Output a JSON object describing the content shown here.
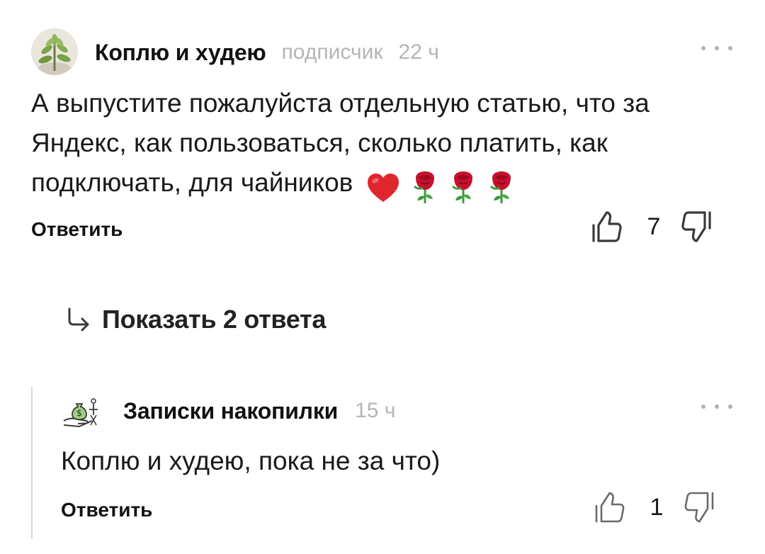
{
  "comment_main": {
    "author": "Коплю и худею",
    "role": "подписчик",
    "time": "22 ч",
    "text": "А выпустите пожалуйста отдельную статью, что за Яндекс, как пользоваться, сколько платить, как подключать, для чайников",
    "emojis": [
      "heart-emoji",
      "rose-emoji",
      "rose-emoji",
      "rose-emoji"
    ],
    "reply_label": "Ответить",
    "likes": "7",
    "avatar_icon": "succulent-plant-avatar"
  },
  "show_replies": {
    "label": "Показать 2 ответа",
    "icon": "reply-arrow-icon"
  },
  "comment_reply": {
    "author": "Записки накопилки",
    "time": "15 ч",
    "text": "Коплю и худею, пока не за что)",
    "reply_label": "Ответить",
    "likes": "1",
    "avatar_icon": "money-bag-hand-avatar"
  },
  "colors": {
    "text": "#111111",
    "muted": "#b5b5b5",
    "icon": "#3a3a3a",
    "thread_line": "#d6d6d6",
    "heart": "#e0262d",
    "rose": "#c8102e",
    "leaf": "#3c9a3c"
  }
}
